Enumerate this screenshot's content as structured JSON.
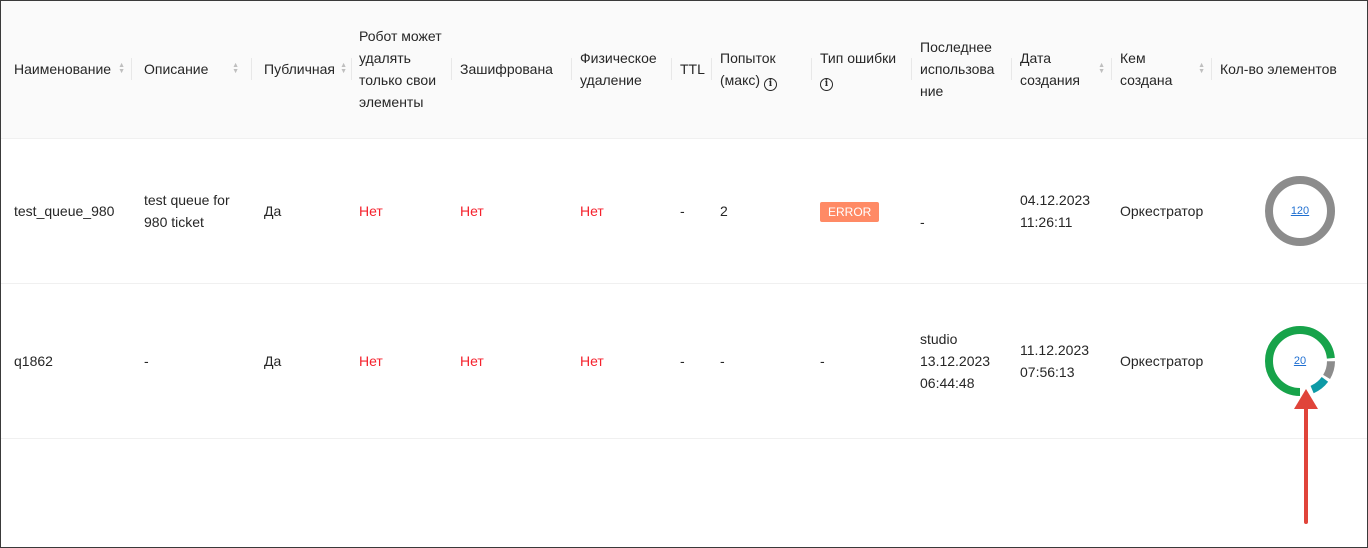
{
  "table": {
    "columns": [
      {
        "label": "Наименование",
        "sortable": true,
        "info": false
      },
      {
        "label": "Описание",
        "sortable": true,
        "info": false
      },
      {
        "label": "Публичная",
        "sortable": true,
        "info": false
      },
      {
        "label": "Робот может удалять только свои элементы",
        "sortable": false,
        "info": false
      },
      {
        "label": "Зашифрована",
        "sortable": false,
        "info": false
      },
      {
        "label": "Физическое удаление",
        "sortable": false,
        "info": false
      },
      {
        "label": "TTL",
        "sortable": false,
        "info": false
      },
      {
        "label": "Попыток (макс)",
        "sortable": false,
        "info": true
      },
      {
        "label": "Тип ошибки",
        "sortable": false,
        "info": true
      },
      {
        "label": "Последнее использова ние",
        "sortable": false,
        "info": false
      },
      {
        "label": "Дата создания",
        "sortable": true,
        "info": false
      },
      {
        "label": "Кем создана",
        "sortable": true,
        "info": false
      },
      {
        "label": "Кол-во элементов",
        "sortable": false,
        "info": false
      }
    ],
    "rows": [
      {
        "name": "test_queue_980",
        "description": "test queue for 980 ticket",
        "public": "Да",
        "robot_own_only": "Нет",
        "encrypted": "Нет",
        "physical_delete": "Нет",
        "ttl": "-",
        "max_attempts": "2",
        "error_type": "ERROR",
        "last_used": "-",
        "created": "04.12.2023 11:26:11",
        "created_by": "Оркестратор",
        "count": "120",
        "donut": [
          {
            "fraction": 1.0,
            "color": "#8c8c8c"
          }
        ]
      },
      {
        "name": "q1862",
        "description": "-",
        "public": "Да",
        "robot_own_only": "Нет",
        "encrypted": "Нет",
        "physical_delete": "Нет",
        "ttl": "-",
        "max_attempts": "-",
        "error_type": "-",
        "last_used": "studio 13.12.2023 06:44:48",
        "created": "11.12.2023 07:56:13",
        "created_by": "Оркестратор",
        "count": "20",
        "donut": [
          {
            "fraction": 0.75,
            "color": "#17a34a"
          },
          {
            "fraction": 0.1,
            "color": "#8c8c8c"
          },
          {
            "fraction": 0.1,
            "color": "#0d9aa6"
          }
        ]
      }
    ]
  },
  "colors": {
    "error_tag": "#ff8a65",
    "negative_text": "#f5222d",
    "annotation_arrow": "#e0443a"
  }
}
